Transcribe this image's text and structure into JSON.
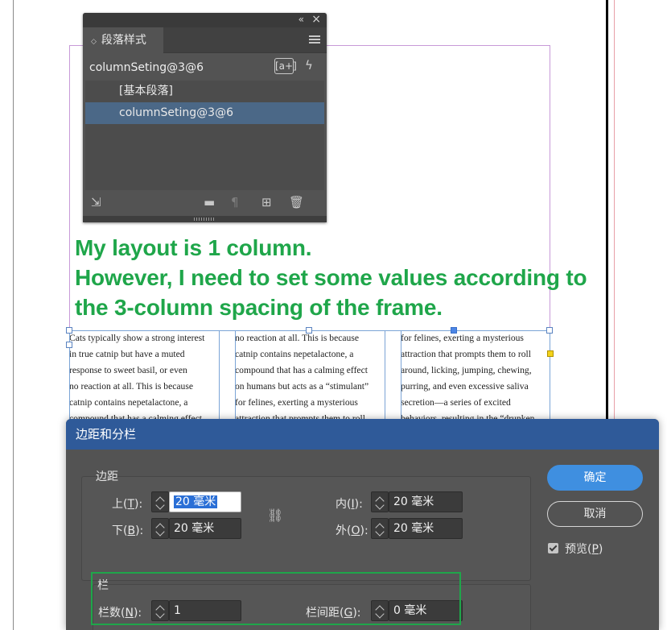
{
  "document": {
    "annotation_lines": [
      "My layout is 1 column.",
      "However, I need to set some values according to",
      "the 3-column spacing of the frame."
    ],
    "columns": [
      [
        "Cats typically show a strong interest",
        "in true catnip but have a muted",
        "response to sweet basil, or even",
        "no reaction at all. This is because",
        "catnip contains nepetalactone, a",
        "compound that has a calming effect"
      ],
      [
        "no reaction at all. This is because",
        "catnip contains nepetalactone, a",
        "compound that has a calming effect",
        "on humans but acts as a “stimulant”",
        "for felines, exerting a mysterious",
        "attraction that prompts them to roll"
      ],
      [
        "for felines, exerting a mysterious",
        "attraction that prompts them to roll",
        "around, licking, jumping, chewing,",
        "purring, and even excessive saliva",
        "secretion—a series of excited",
        "behaviors, resulting in the “drunken"
      ]
    ]
  },
  "paragraph_styles_panel": {
    "collapse_icon": "«",
    "close_icon": "×",
    "tab_label": "段落样式",
    "current_style": "columnSeting@3@6",
    "auto_import_label": "[a+]",
    "items": [
      {
        "label": "[基本段落]"
      },
      {
        "label": "columnSeting@3@6"
      }
    ]
  },
  "dialog": {
    "title": "边距和分栏",
    "margins_group": "边距",
    "columns_group": "栏",
    "fields": {
      "top": {
        "label": "上(",
        "key": "T",
        "suffix": "):",
        "value": "20 毫米"
      },
      "bottom": {
        "label": "下(",
        "key": "B",
        "suffix": "):",
        "value": "20 毫米"
      },
      "inside": {
        "label": "内(",
        "key": "I",
        "suffix": "):",
        "value": "20 毫米"
      },
      "outside": {
        "label": "外(",
        "key": "O",
        "suffix": "):",
        "value": "20 毫米"
      },
      "number": {
        "label": "栏数(",
        "key": "N",
        "suffix": "):",
        "value": "1"
      },
      "gutter": {
        "label": "栏间距(",
        "key": "G",
        "suffix": "):",
        "value": "0 毫米"
      }
    },
    "ok_label": "确定",
    "cancel_label": "取消",
    "preview": {
      "label": "预览(",
      "key": "P",
      "suffix": ")",
      "checked": true
    }
  },
  "colors": {
    "annotation": "#1fa64a",
    "dialog_title_bar": "#2f5a99",
    "ok_button": "#3f8fe0",
    "selected_style": "#4b6887"
  }
}
